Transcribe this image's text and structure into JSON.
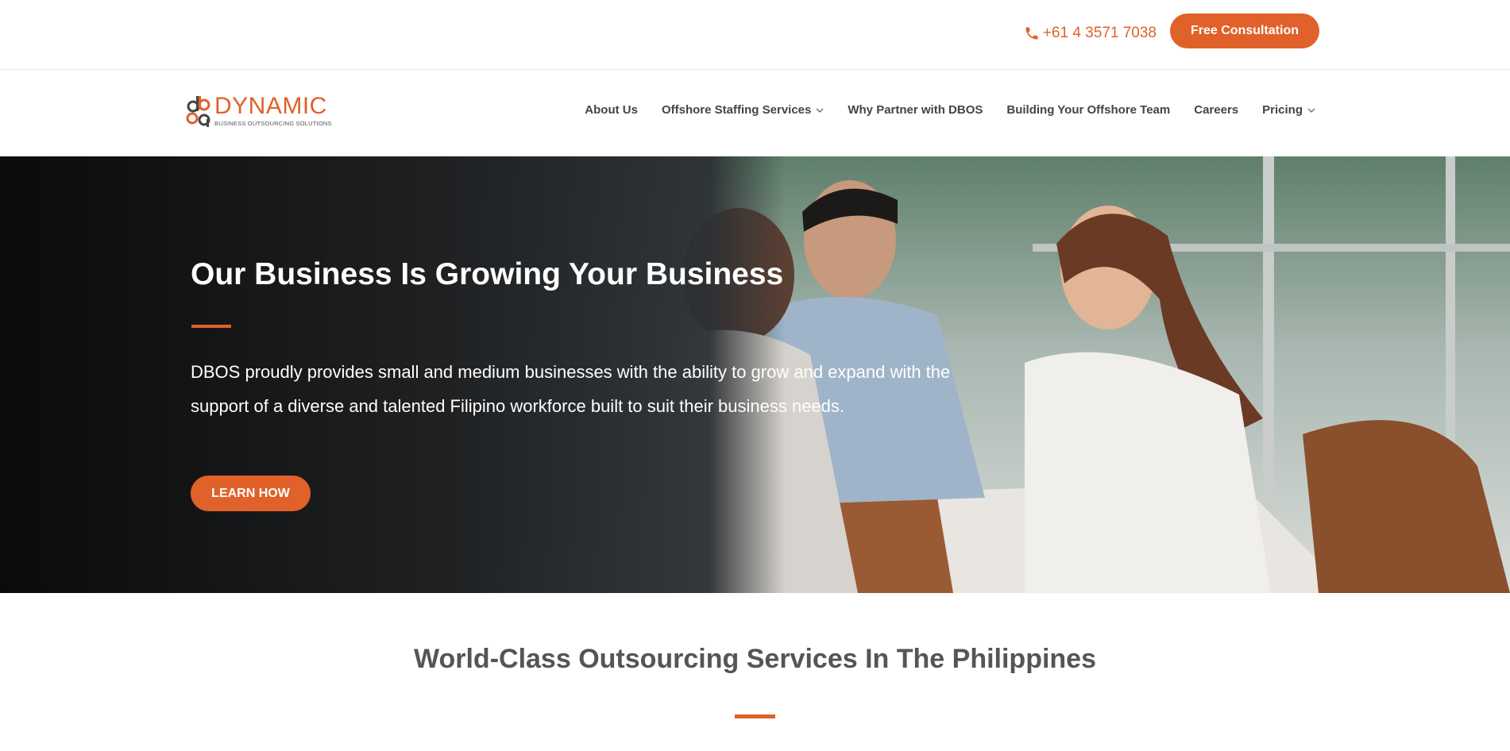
{
  "topbar": {
    "phone": "+61 4 3571 7038",
    "consult_label": "Free Consultation"
  },
  "header": {
    "logo": {
      "name": "DYNAMIC",
      "tagline": "BUSINESS OUTSOURCING SOLUTIONS"
    },
    "nav": [
      {
        "label": "About Us",
        "has_dropdown": false
      },
      {
        "label": "Offshore Staffing Services",
        "has_dropdown": true
      },
      {
        "label": "Why Partner with DBOS",
        "has_dropdown": false
      },
      {
        "label": "Building Your Offshore Team",
        "has_dropdown": false
      },
      {
        "label": "Careers",
        "has_dropdown": false
      },
      {
        "label": "Pricing",
        "has_dropdown": true
      }
    ]
  },
  "hero": {
    "title": "Our Business Is Growing Your Business",
    "text": "DBOS proudly provides small and medium businesses with the ability to grow and expand with the support of a diverse and talented Filipino workforce built to suit their business needs.",
    "cta_label": "LEARN HOW",
    "image_description_icon": "office-meeting-photo"
  },
  "section": {
    "title": "World-Class Outsourcing Services In The Philippines"
  },
  "colors": {
    "accent": "#e0612a",
    "nav_text": "#444444",
    "hero_text": "#ffffff"
  }
}
